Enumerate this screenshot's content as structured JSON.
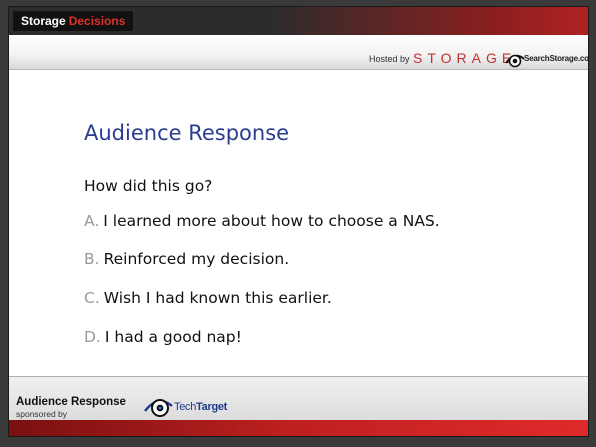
{
  "header": {
    "brand_word1": "Storage",
    "brand_word2": "Decisions",
    "hosted_by": "Hosted by",
    "storage_logo": "STORAGE",
    "sponsor_site": "SearchStorage.com"
  },
  "slide": {
    "title": "Audience Response",
    "question": "How did this go?",
    "options": [
      {
        "letter": "A.",
        "text": "I learned more about how to choose a NAS."
      },
      {
        "letter": "B.",
        "text": "Reinforced my decision."
      },
      {
        "letter": "C.",
        "text": "Wish I had known this earlier."
      },
      {
        "letter": "D.",
        "text": "I had a good nap!"
      }
    ]
  },
  "footer": {
    "title": "Audience Response",
    "subtitle": "sponsored by",
    "sponsor_tech": "Tech",
    "sponsor_target": "Target"
  },
  "colors": {
    "title_blue": "#2a3d8f",
    "brand_red": "#e0312a",
    "letter_gray": "#9a9a9a"
  }
}
